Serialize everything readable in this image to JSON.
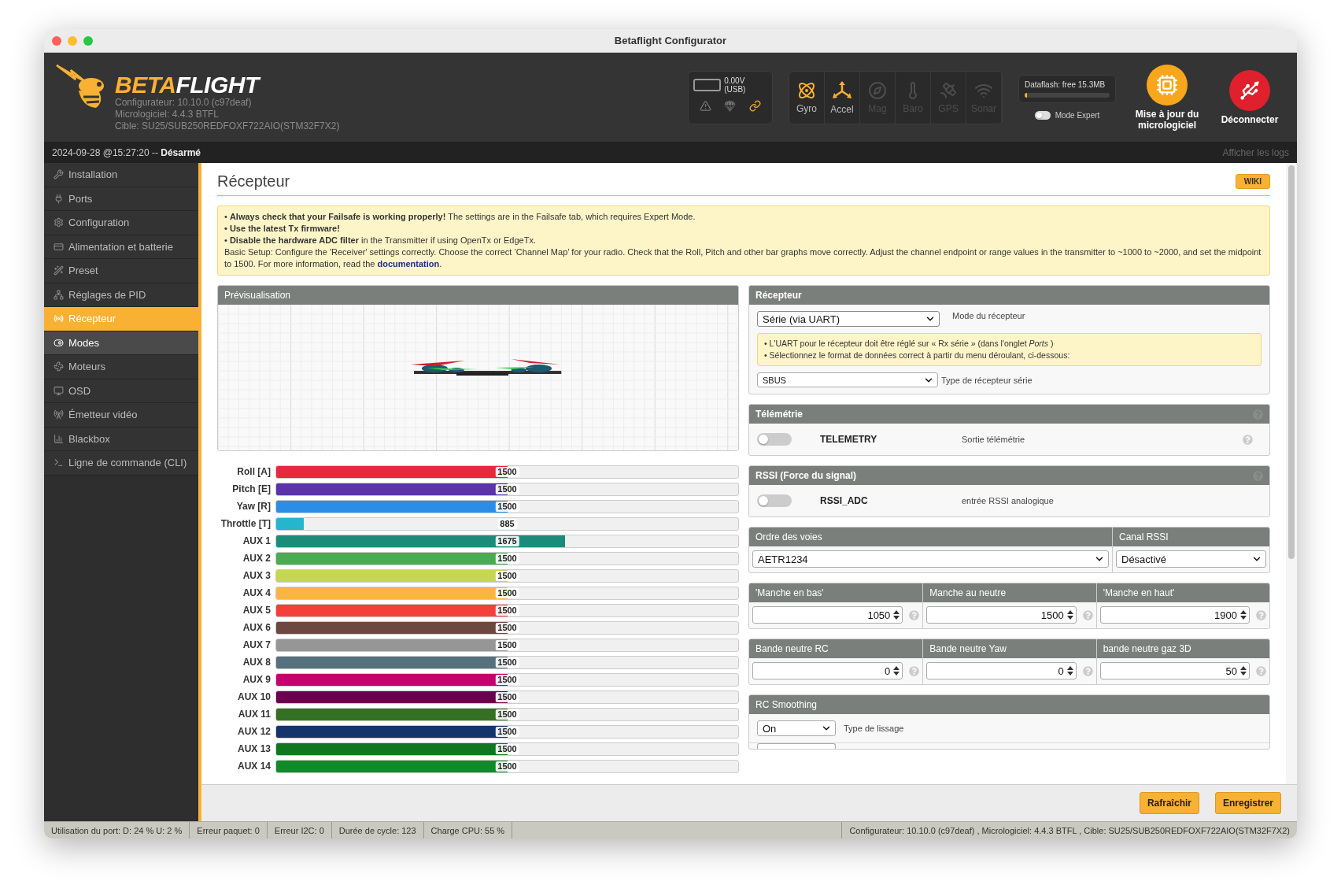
{
  "window": {
    "title": "Betaflight Configurator"
  },
  "header": {
    "logo": [
      "BETA",
      "FLIGHT"
    ],
    "versions": [
      "Configurateur: 10.10.0 (c97deaf)",
      "Micrologiciel: 4.4.3 BTFL",
      "Cible: SU25/SUB250REDFOXF722AIO(STM32F7X2)"
    ],
    "battery": {
      "reading": "0.00V (USB)"
    },
    "status_icons": [
      {
        "on": false
      },
      {
        "on": false
      },
      {
        "on": true
      }
    ],
    "sensors": [
      {
        "label": "Gyro",
        "on": true
      },
      {
        "label": "Accel",
        "on": true
      },
      {
        "label": "Mag",
        "on": false
      },
      {
        "label": "Baro",
        "on": false
      },
      {
        "label": "GPS",
        "on": false
      },
      {
        "label": "Sonar",
        "on": false
      }
    ],
    "dataflash": {
      "label": "Dataflash: free 15.3MB",
      "level": 0.03
    },
    "expert_mode": {
      "label": "Mode Expert",
      "on": false
    },
    "firmware_button": "Mise à jour du micrologiciel",
    "disconnect_button": "Déconnecter"
  },
  "status_strip": {
    "date": "2024-09-28 @15:27:20 --",
    "state": "Désarmé",
    "logs": "Afficher les logs"
  },
  "sidebar": {
    "items": [
      {
        "label": "Installation",
        "selected": false,
        "highlighted": false
      },
      {
        "label": "Ports",
        "selected": false,
        "highlighted": false
      },
      {
        "label": "Configuration",
        "selected": false,
        "highlighted": false
      },
      {
        "label": "Alimentation et batterie",
        "selected": false,
        "highlighted": false
      },
      {
        "label": "Preset",
        "selected": false,
        "highlighted": false
      },
      {
        "label": "Réglages de PID",
        "selected": false,
        "highlighted": false
      },
      {
        "label": "Récepteur",
        "selected": true,
        "highlighted": false
      },
      {
        "label": "Modes",
        "selected": false,
        "highlighted": true
      },
      {
        "label": "Moteurs",
        "selected": false,
        "highlighted": false
      },
      {
        "label": "OSD",
        "selected": false,
        "highlighted": false
      },
      {
        "label": "Émetteur vidéo",
        "selected": false,
        "highlighted": false
      },
      {
        "label": "Blackbox",
        "selected": false,
        "highlighted": false
      },
      {
        "label": "Ligne de commande (CLI)",
        "selected": false,
        "highlighted": false
      }
    ]
  },
  "content": {
    "title": "Récepteur",
    "wiki": "WIKI",
    "notice": [
      {
        "kind": "bullet",
        "text": "• **Always check that your Failsafe is working properly!** The settings are in the Failsafe tab, which requires Expert Mode."
      },
      {
        "kind": "bullet-bold",
        "text": "• Use the latest Tx firmware!"
      },
      {
        "kind": "bullet",
        "text": "• **Disable the hardware ADC filter** in the Transmitter if using OpenTx or EdgeTx."
      },
      {
        "kind": "plain",
        "text": "Basic Setup: Configure the 'Receiver' settings correctly. Choose the correct ‘Channel Map’ for your radio. Check that the Roll, Pitch and other bar graphs move correctly. Adjust the channel endpoint or range values in the transmitter to ~1000 to ~2000, and set the midpoint to 1500. For more information, read the ",
        "link": "documentation",
        "after": "."
      }
    ],
    "preview": {
      "title": "Prévisualisation"
    },
    "channels": [
      {
        "name": "Roll [A]",
        "value": "1500",
        "level": 0.5,
        "color": "#e8283c"
      },
      {
        "name": "Pitch [E]",
        "value": "1500",
        "level": 0.5,
        "color": "#5b32a8"
      },
      {
        "name": "Yaw [R]",
        "value": "1500",
        "level": 0.5,
        "color": "#2b8ee6"
      },
      {
        "name": "Throttle [T]",
        "value": "885",
        "level": 0.06,
        "color": "#25b5cc"
      },
      {
        "name": "AUX 1",
        "value": "1675",
        "level": 0.625,
        "color": "#1c8c7a"
      },
      {
        "name": "AUX 2",
        "value": "1500",
        "level": 0.5,
        "color": "#4aab52"
      },
      {
        "name": "AUX 3",
        "value": "1500",
        "level": 0.5,
        "color": "#c5d752"
      },
      {
        "name": "AUX 4",
        "value": "1500",
        "level": 0.5,
        "color": "#fbb444"
      },
      {
        "name": "AUX 5",
        "value": "1500",
        "level": 0.5,
        "color": "#f5403a"
      },
      {
        "name": "AUX 6",
        "value": "1500",
        "level": 0.5,
        "color": "#6c4840"
      },
      {
        "name": "AUX 7",
        "value": "1500",
        "level": 0.5,
        "color": "#969696"
      },
      {
        "name": "AUX 8",
        "value": "1500",
        "level": 0.5,
        "color": "#56717e"
      },
      {
        "name": "AUX 9",
        "value": "1500",
        "level": 0.5,
        "color": "#c7006d"
      },
      {
        "name": "AUX 10",
        "value": "1500",
        "level": 0.5,
        "color": "#6b0050"
      },
      {
        "name": "AUX 11",
        "value": "1500",
        "level": 0.5,
        "color": "#357024"
      },
      {
        "name": "AUX 12",
        "value": "1500",
        "level": 0.5,
        "color": "#15346b"
      },
      {
        "name": "AUX 13",
        "value": "1500",
        "level": 0.5,
        "color": "#10771e"
      },
      {
        "name": "AUX 14",
        "value": "1500",
        "level": 0.5,
        "color": "#138a2a"
      }
    ],
    "receiver": {
      "title": "Récepteur",
      "mode": "Série (via UART)",
      "mode_label": "Mode du récepteur",
      "notes": [
        "• L'UART pour le récepteur doit être réglé sur « Rx série » (dans l'onglet *Ports* )",
        "• Sélectionnez le format de données correct à partir du menu déroulant, ci-dessous:"
      ],
      "serial_type": "SBUS",
      "serial_type_label": "Type de récepteur série"
    },
    "telemetry": {
      "title": "Télémétrie",
      "on": false,
      "name": "TELEMETRY",
      "description": "Sortie télémétrie"
    },
    "rssi": {
      "title": "RSSI (Force du signal)",
      "on": false,
      "name": "RSSI_ADC",
      "description": "entrée RSSI analogique"
    },
    "channel_map": {
      "label": "Ordre des voies",
      "value": "AETR1234",
      "rssi_label": "Canal RSSI",
      "rssi_value": "Désactivé"
    },
    "stick_ranges": [
      {
        "label": "'Manche en bas'",
        "value": "1050"
      },
      {
        "label": "Manche au neutre",
        "value": "1500"
      },
      {
        "label": "'Manche en haut'",
        "value": "1900"
      }
    ],
    "deadbands": [
      {
        "label": "Bande neutre RC",
        "value": "0"
      },
      {
        "label": "Bande neutre Yaw",
        "value": "0"
      },
      {
        "label": "bande neutre gaz 3D",
        "value": "50"
      }
    ],
    "rc_smoothing": {
      "title": "RC Smoothing",
      "value": "On",
      "label": "Type de lissage"
    },
    "buttons": [
      "Rafraîchir",
      "Enregistrer"
    ]
  },
  "status_bar": {
    "items": [
      "Utilisation du port: D: 24 % U: 2 %",
      "Erreur paquet: 0",
      "Erreur I2C: 0",
      "Durée de cycle: 123",
      "Charge CPU: 55 %"
    ],
    "version": "Configurateur: 10.10.0 (c97deaf) , Micrologiciel: 4.4.3 BTFL , Cible: SU25/SUB250REDFOXF722AIO(STM32F7X2)"
  }
}
